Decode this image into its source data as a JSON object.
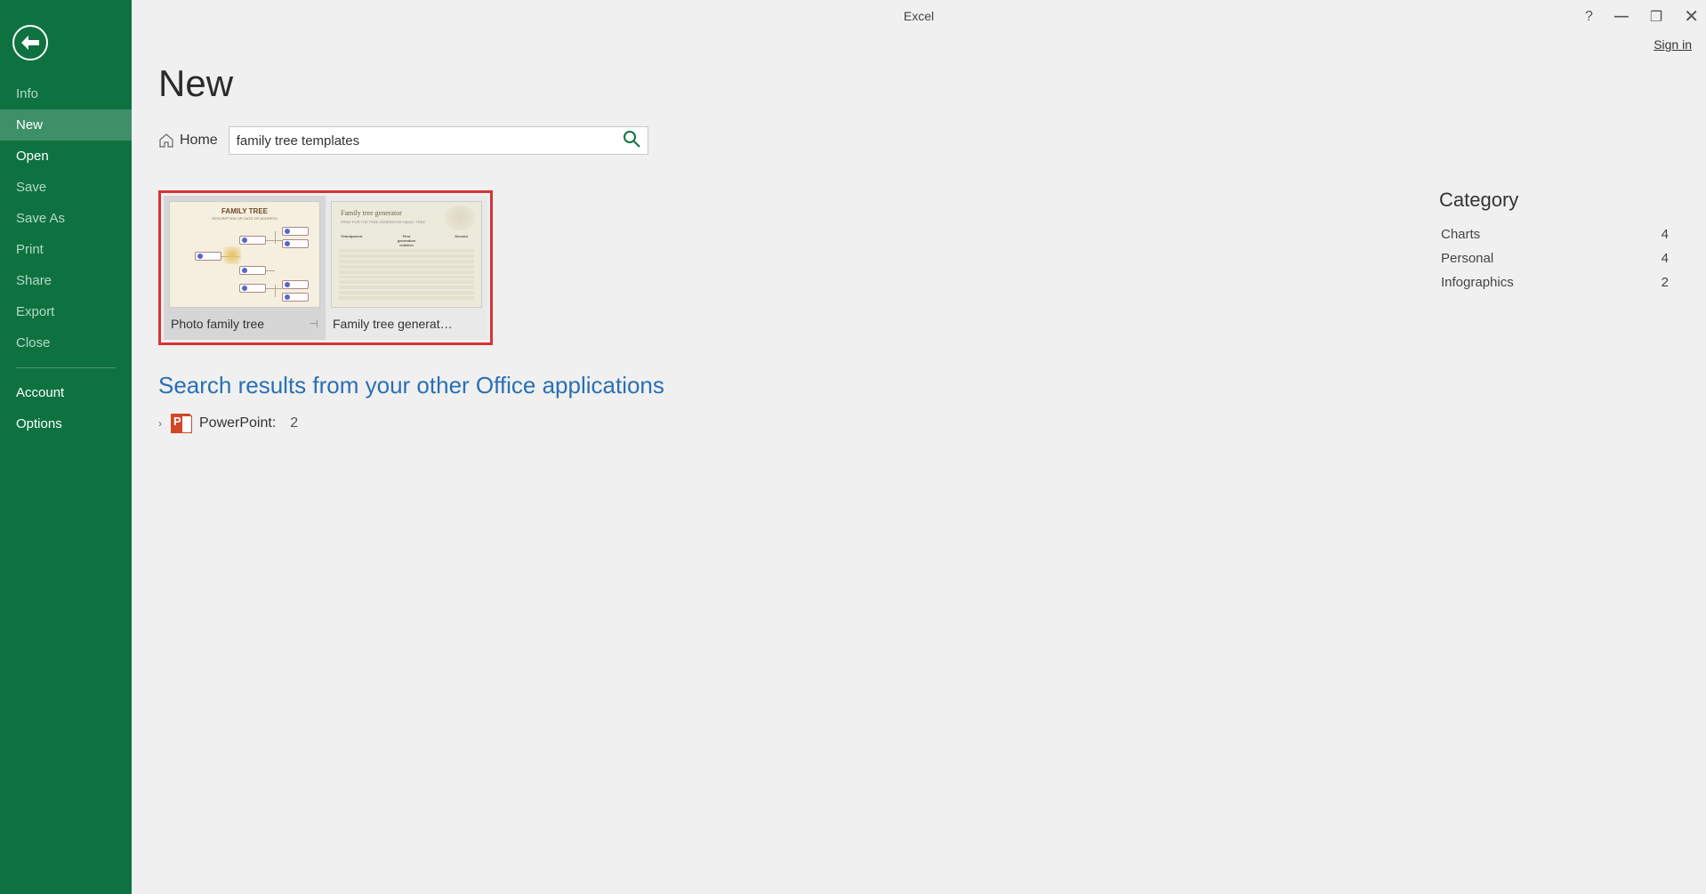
{
  "app_title": "Excel",
  "signin_label": "Sign in",
  "sidebar": {
    "items": [
      {
        "label": "Info",
        "enabled": false,
        "active": false
      },
      {
        "label": "New",
        "enabled": true,
        "active": true
      },
      {
        "label": "Open",
        "enabled": true,
        "active": false
      },
      {
        "label": "Save",
        "enabled": false,
        "active": false
      },
      {
        "label": "Save As",
        "enabled": false,
        "active": false
      },
      {
        "label": "Print",
        "enabled": false,
        "active": false
      },
      {
        "label": "Share",
        "enabled": false,
        "active": false
      },
      {
        "label": "Export",
        "enabled": false,
        "active": false
      },
      {
        "label": "Close",
        "enabled": false,
        "active": false
      }
    ],
    "bottom": [
      {
        "label": "Account"
      },
      {
        "label": "Options"
      }
    ]
  },
  "page_title": "New",
  "breadcrumb": {
    "home": "Home"
  },
  "search": {
    "value": "family tree templates"
  },
  "templates": [
    {
      "label": "Photo family tree",
      "thumb_title": "FAMILY TREE",
      "selected": true
    },
    {
      "label": "Family tree generat…",
      "thumb_title": "Family tree generator",
      "selected": false
    }
  ],
  "other_results": {
    "heading": "Search results from your other Office applications",
    "items": [
      {
        "app": "PowerPoint:",
        "count": "2"
      }
    ]
  },
  "category": {
    "title": "Category",
    "items": [
      {
        "label": "Charts",
        "count": "4"
      },
      {
        "label": "Personal",
        "count": "4"
      },
      {
        "label": "Infographics",
        "count": "2"
      }
    ]
  }
}
